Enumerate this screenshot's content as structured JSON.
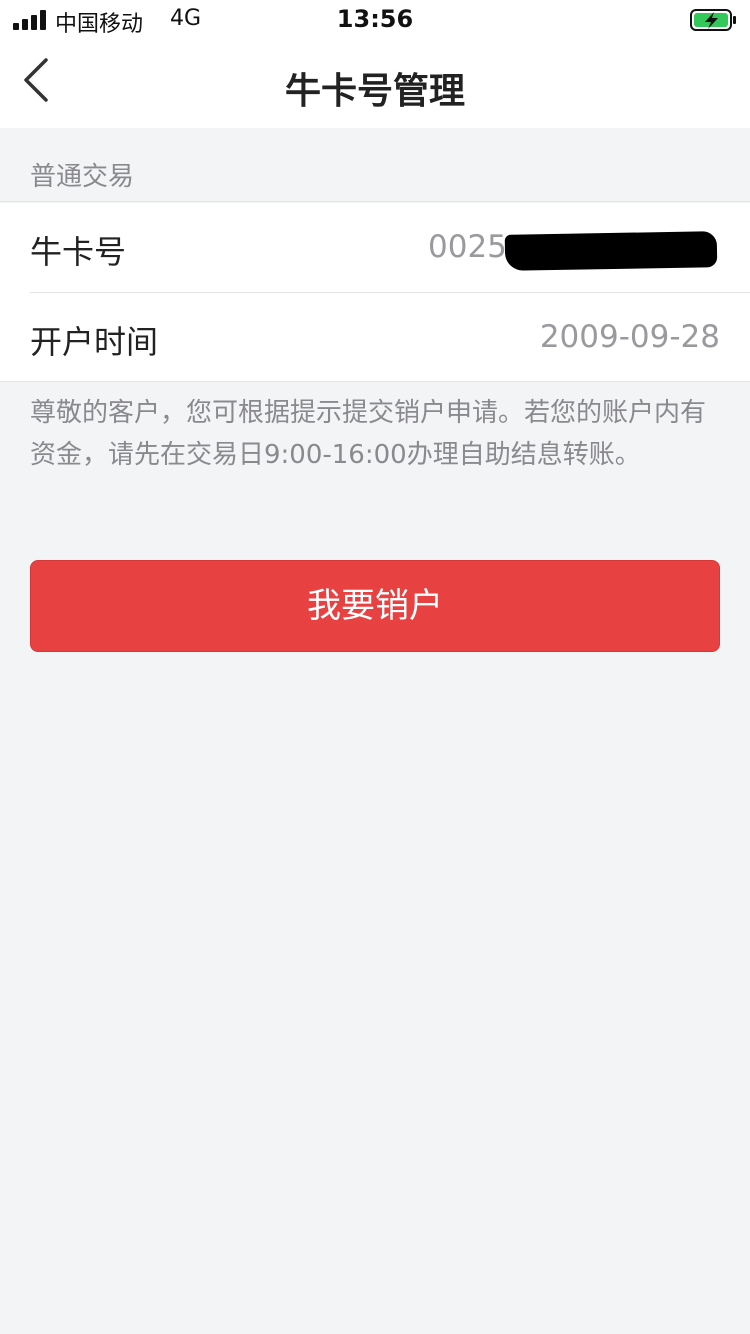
{
  "status_bar": {
    "carrier": "中国移动",
    "network": "4G",
    "time": "13:56",
    "signal_icon": "signal-bars-icon",
    "battery_icon": "battery-charging-icon",
    "battery_color": "#34c759"
  },
  "nav": {
    "title": "牛卡号管理",
    "back_icon": "chevron-left-icon"
  },
  "section": {
    "title": "普通交易"
  },
  "rows": [
    {
      "label": "牛卡号",
      "value": "0025"
    },
    {
      "label": "开户时间",
      "value": "2009-09-28"
    }
  ],
  "notice": "尊敬的客户，您可根据提示提交销户申请。若您的账户内有资金，请先在交易日9:00-16:00办理自助结息转账。",
  "button": {
    "label": "我要销户",
    "color": "#e84141"
  }
}
